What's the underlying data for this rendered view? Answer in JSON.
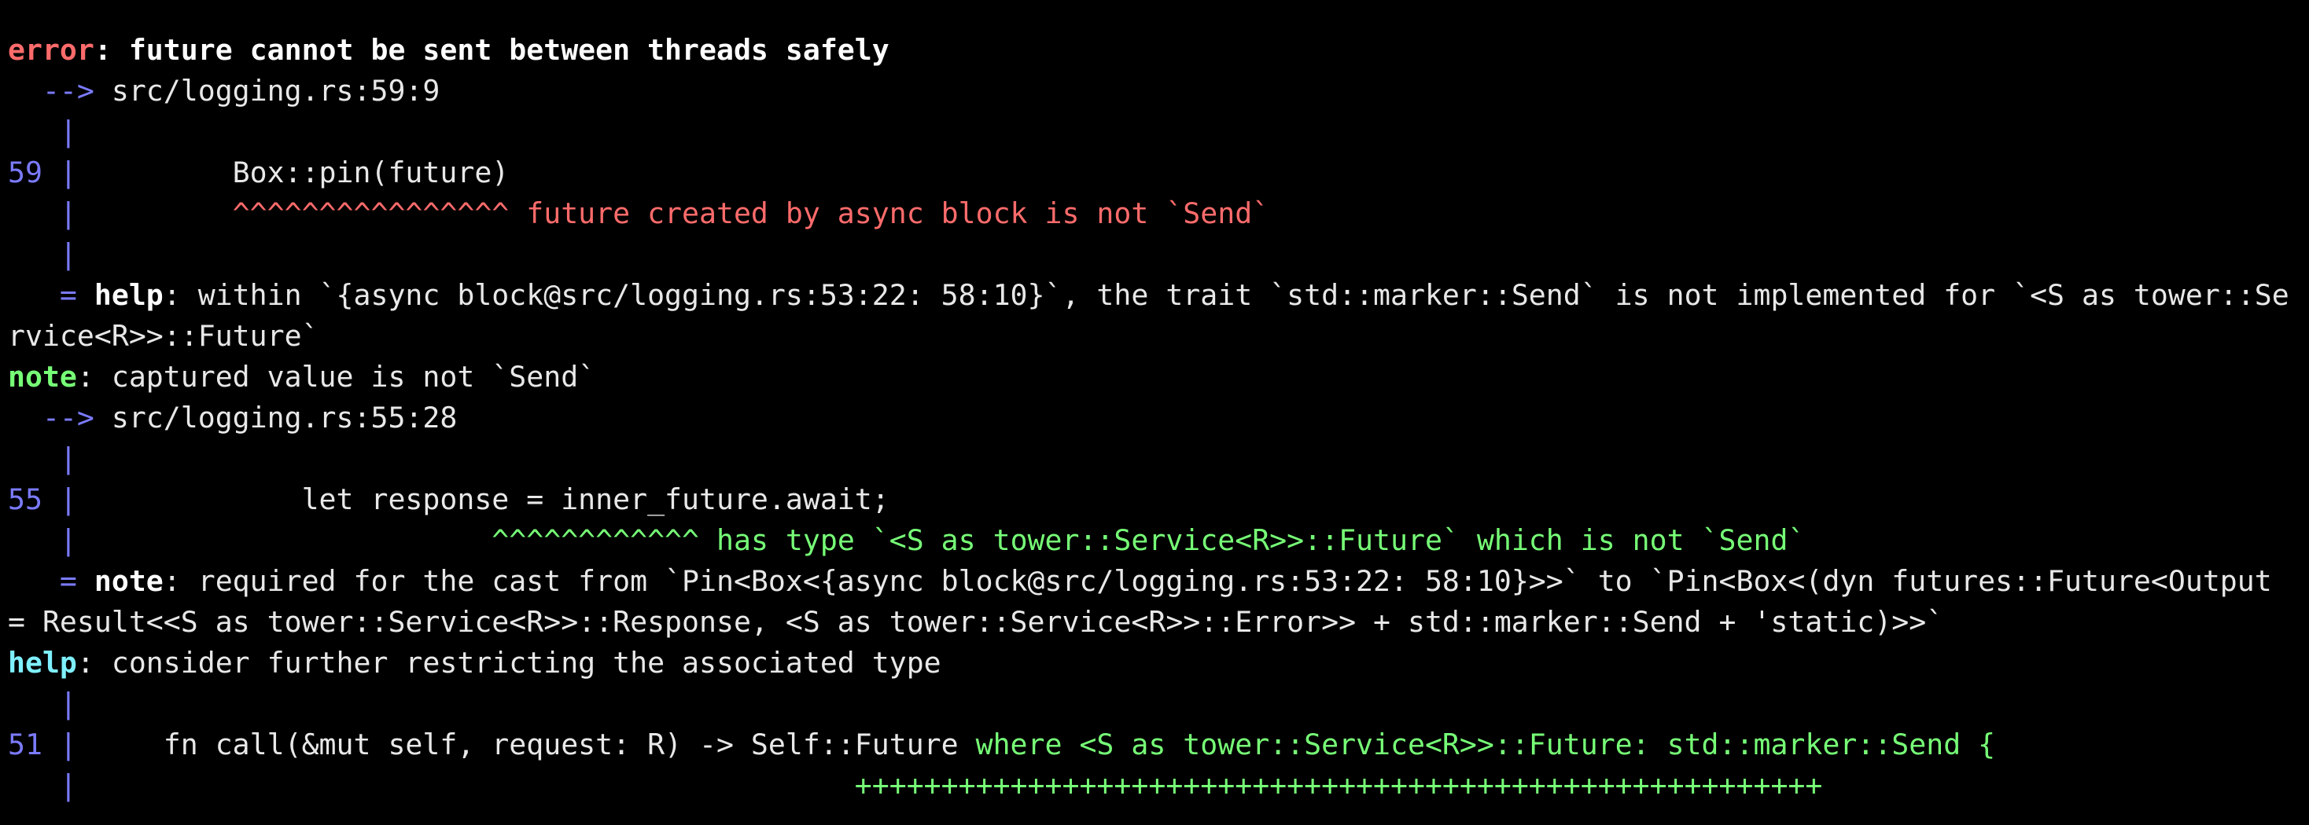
{
  "colors": {
    "background": "#000000",
    "text": "#e8e8e8",
    "error": "#ff6b6b",
    "gutter": "#7b7bff",
    "note_green": "#77ff77",
    "help_cyan": "#7ff0ff"
  },
  "diagnostic": {
    "error": {
      "level": "error",
      "message": ": future cannot be sent between threads safely",
      "location_arrow": "  --> ",
      "location": "src/logging.rs:59:9",
      "blank_pipe_1": "   |",
      "code_lineno": "59 |",
      "code": "         Box::pin(future)",
      "pipe_underline": "   |",
      "underline": "         ^^^^^^^^^^^^^^^^",
      "underline_label": " future created by async block is not `Send`",
      "blank_pipe_2": "   |"
    },
    "help1": {
      "prefix": "   = ",
      "label": "help",
      "text_line1": ": within `{async block@src/logging.rs:53:22: 58:10}`, the trait `std::marker::Send` is not implemented for `<S as tower::Se",
      "text_line2": "rvice<R>>::Future`"
    },
    "note1": {
      "label": "note",
      "message": ": captured value is not `Send`",
      "location_arrow": "  --> ",
      "location": "src/logging.rs:55:28",
      "blank_pipe_1": "   |",
      "code_lineno": "55 |",
      "code": "             let response = inner_future.await;",
      "pipe_underline": "   |",
      "underline": "                        ^^^^^^^^^^^^",
      "underline_label": " has type `<S as tower::Service<R>>::Future` which is not `Send`"
    },
    "note2": {
      "prefix": "   = ",
      "label": "note",
      "text_line1": ": required for the cast from `Pin<Box<{async block@src/logging.rs:53:22: 58:10}>>` to `Pin<Box<(dyn futures::Future<Output",
      "text_line2": "= Result<<S as tower::Service<R>>::Response, <S as tower::Service<R>>::Error>> + std::marker::Send + 'static)>>`"
    },
    "help2": {
      "label": "help",
      "message": ": consider further restricting the associated type",
      "blank_pipe_1": "   |",
      "code_lineno": "51 |",
      "code": "     fn call(&mut self, request: R) -> Self::Future",
      "suggestion": " where <S as tower::Service<R>>::Future: std::marker::Send {",
      "pipe_underline": "   |",
      "plus_marks": "                                             ++++++++++++++++++++++++++++++++++++++++++++++++++++++++"
    }
  }
}
